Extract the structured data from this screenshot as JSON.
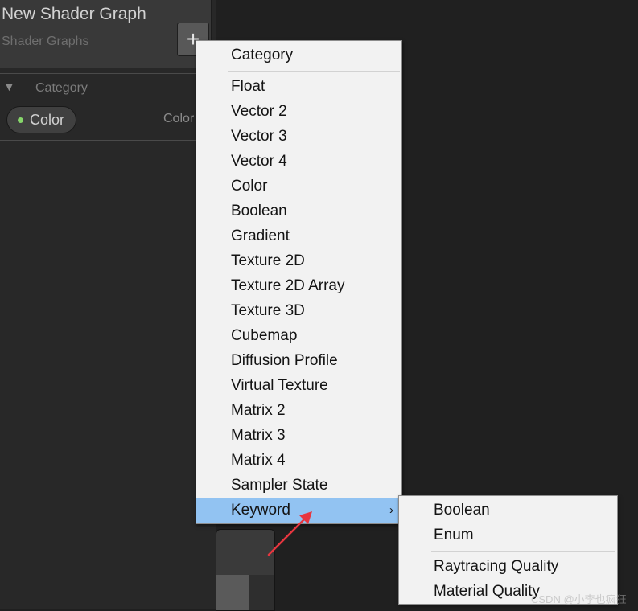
{
  "blackboard": {
    "title": "New Shader Graph",
    "subtitle": "Shader Graphs",
    "add_label": "+",
    "category": {
      "arrow": "▼",
      "label": "Category"
    },
    "property": {
      "name": "Color",
      "type": "Color",
      "dot_color": "#86d66a"
    }
  },
  "menu": {
    "header": "Category",
    "items": [
      "Float",
      "Vector 2",
      "Vector 3",
      "Vector 4",
      "Color",
      "Boolean",
      "Gradient",
      "Texture 2D",
      "Texture 2D Array",
      "Texture 3D",
      "Cubemap",
      "Diffusion Profile",
      "Virtual Texture",
      "Matrix 2",
      "Matrix 3",
      "Matrix 4",
      "Sampler State"
    ],
    "keyword": {
      "label": "Keyword",
      "arrow": "›"
    },
    "highlight_color": "#92c3f2"
  },
  "submenu": {
    "group1": [
      "Boolean",
      "Enum"
    ],
    "group2": [
      "Raytracing Quality",
      "Material Quality"
    ]
  },
  "annotation": {
    "color": "#e8363f"
  },
  "watermark": "CSDN @小李也疯狂"
}
